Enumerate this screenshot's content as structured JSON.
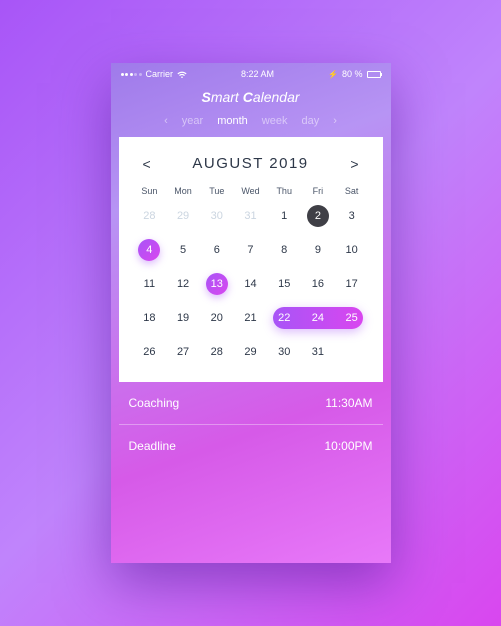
{
  "status": {
    "carrier": "Carrier",
    "time": "8:22 AM",
    "battery": "80 %",
    "lightning": "⚡"
  },
  "app": {
    "title_s": "S",
    "title_mart": "mart ",
    "title_c": "C",
    "title_alendar": "alendar"
  },
  "tabs": {
    "prev": "‹",
    "year": "year",
    "month": "month",
    "week": "week",
    "day": "day",
    "next": "›"
  },
  "calendar": {
    "prev": "<",
    "title": "AUGUST 2019",
    "next": ">",
    "dow": [
      "Sun",
      "Mon",
      "Tue",
      "Wed",
      "Thu",
      "Fri",
      "Sat"
    ],
    "cells": [
      {
        "n": "28",
        "out": true
      },
      {
        "n": "29",
        "out": true
      },
      {
        "n": "30",
        "out": true
      },
      {
        "n": "31",
        "out": true
      },
      {
        "n": "1"
      },
      {
        "n": "2",
        "badge": "dark"
      },
      {
        "n": "3"
      },
      {
        "n": "4",
        "badge": "purple"
      },
      {
        "n": "5"
      },
      {
        "n": "6"
      },
      {
        "n": "7"
      },
      {
        "n": "8"
      },
      {
        "n": "9"
      },
      {
        "n": "10"
      },
      {
        "n": "11"
      },
      {
        "n": "12"
      },
      {
        "n": "13",
        "badge": "purple"
      },
      {
        "n": "14"
      },
      {
        "n": "15"
      },
      {
        "n": "16"
      },
      {
        "n": "17"
      },
      {
        "n": "18"
      },
      {
        "n": "19"
      },
      {
        "n": "20"
      },
      {
        "n": "21"
      },
      {
        "n": "22",
        "range": true
      },
      {
        "n": "24",
        "range": true
      },
      {
        "n": "25",
        "range": true
      },
      {
        "n": "26"
      },
      {
        "n": "27"
      },
      {
        "n": "28"
      },
      {
        "n": "29"
      },
      {
        "n": "30"
      },
      {
        "n": "31"
      },
      {
        "n": ""
      }
    ]
  },
  "events": [
    {
      "title": "Coaching",
      "time": "11:30AM"
    },
    {
      "title": "Deadline",
      "time": "10:00PM"
    }
  ]
}
